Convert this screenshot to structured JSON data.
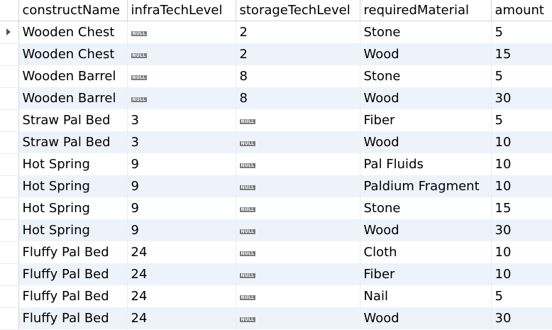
{
  "columns": [
    "constructName",
    "infraTechLevel",
    "storageTechLevel",
    "requiredMaterial",
    "amount"
  ],
  "null_label": "NULL",
  "selected_row": 0,
  "rows": [
    [
      "Wooden Chest",
      null,
      "2",
      "Stone",
      "5"
    ],
    [
      "Wooden Chest",
      null,
      "2",
      "Wood",
      "15"
    ],
    [
      "Wooden Barrel",
      null,
      "8",
      "Stone",
      "5"
    ],
    [
      "Wooden Barrel",
      null,
      "8",
      "Wood",
      "30"
    ],
    [
      "Straw Pal Bed",
      "3",
      null,
      "Fiber",
      "5"
    ],
    [
      "Straw Pal Bed",
      "3",
      null,
      "Wood",
      "10"
    ],
    [
      "Hot Spring",
      "9",
      null,
      "Pal Fluids",
      "10"
    ],
    [
      "Hot Spring",
      "9",
      null,
      "Paldium Fragment",
      "10"
    ],
    [
      "Hot Spring",
      "9",
      null,
      "Stone",
      "15"
    ],
    [
      "Hot Spring",
      "9",
      null,
      "Wood",
      "30"
    ],
    [
      "Fluffy Pal Bed",
      "24",
      null,
      "Cloth",
      "10"
    ],
    [
      "Fluffy Pal Bed",
      "24",
      null,
      "Fiber",
      "10"
    ],
    [
      "Fluffy Pal Bed",
      "24",
      null,
      "Nail",
      "5"
    ],
    [
      "Fluffy Pal Bed",
      "24",
      null,
      "Wood",
      "30"
    ]
  ],
  "colors": {
    "alt_row": "#eef3fb",
    "null_badge": "#7c7c7c",
    "gridline": "#d5d5d5"
  }
}
